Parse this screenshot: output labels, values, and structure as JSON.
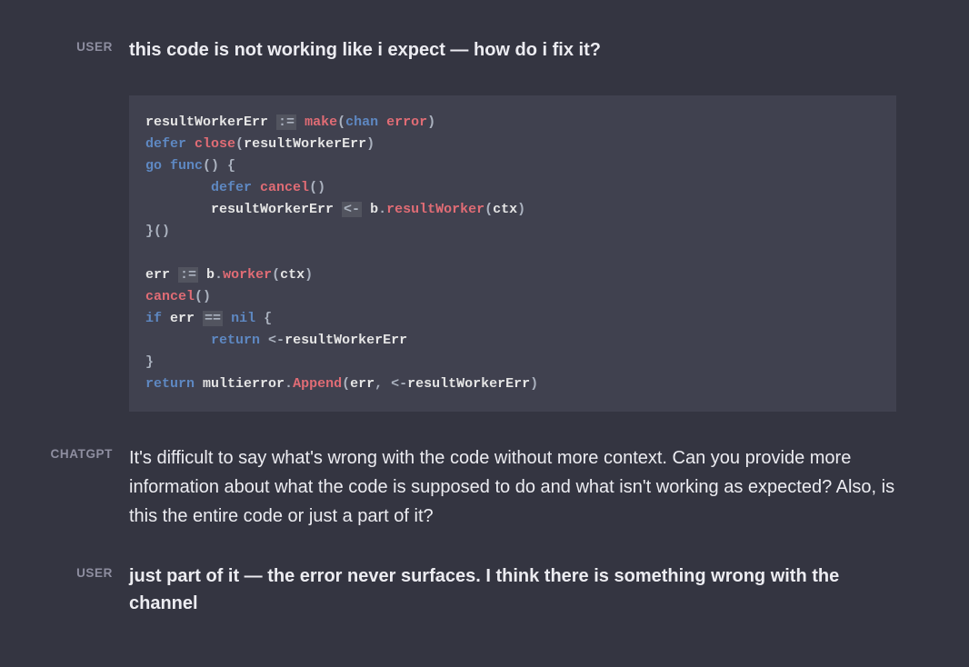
{
  "colors": {
    "background": "#343541",
    "codeBackground": "#40414f",
    "textPrimary": "#ececf1",
    "textMuted": "#8e8ea0",
    "keyword": "#5e88c2",
    "function": "#e06c75",
    "punctuation": "#abb2bf"
  },
  "messages": [
    {
      "role": "USER",
      "text": "this code is not working like i expect — how do i fix it?",
      "codeLanguage": "go",
      "code": {
        "tokens": [
          [
            {
              "t": "ident",
              "v": "resultWorkerErr "
            },
            {
              "t": "op",
              "v": ":="
            },
            {
              "t": "ident",
              "v": " "
            },
            {
              "t": "builtin",
              "v": "make"
            },
            {
              "t": "punct",
              "v": "("
            },
            {
              "t": "kw",
              "v": "chan"
            },
            {
              "t": "ident",
              "v": " "
            },
            {
              "t": "type",
              "v": "error"
            },
            {
              "t": "punct",
              "v": ")"
            }
          ],
          [
            {
              "t": "kw",
              "v": "defer"
            },
            {
              "t": "ident",
              "v": " "
            },
            {
              "t": "builtin",
              "v": "close"
            },
            {
              "t": "punct",
              "v": "("
            },
            {
              "t": "ident",
              "v": "resultWorkerErr"
            },
            {
              "t": "punct",
              "v": ")"
            }
          ],
          [
            {
              "t": "kw",
              "v": "go"
            },
            {
              "t": "ident",
              "v": " "
            },
            {
              "t": "kw",
              "v": "func"
            },
            {
              "t": "punct",
              "v": "() {"
            }
          ],
          [
            {
              "t": "ident",
              "v": "        "
            },
            {
              "t": "kw",
              "v": "defer"
            },
            {
              "t": "ident",
              "v": " "
            },
            {
              "t": "builtin",
              "v": "cancel"
            },
            {
              "t": "punct",
              "v": "()"
            }
          ],
          [
            {
              "t": "ident",
              "v": "        resultWorkerErr "
            },
            {
              "t": "chan-arrow-hl",
              "v": "<-"
            },
            {
              "t": "ident",
              "v": " b"
            },
            {
              "t": "punct",
              "v": "."
            },
            {
              "t": "builtin",
              "v": "resultWorker"
            },
            {
              "t": "punct",
              "v": "("
            },
            {
              "t": "ident",
              "v": "ctx"
            },
            {
              "t": "punct",
              "v": ")"
            }
          ],
          [
            {
              "t": "punct",
              "v": "}()"
            }
          ],
          [
            {
              "t": "ident",
              "v": ""
            }
          ],
          [
            {
              "t": "ident",
              "v": "err "
            },
            {
              "t": "op",
              "v": ":="
            },
            {
              "t": "ident",
              "v": " b"
            },
            {
              "t": "punct",
              "v": "."
            },
            {
              "t": "builtin",
              "v": "worker"
            },
            {
              "t": "punct",
              "v": "("
            },
            {
              "t": "ident",
              "v": "ctx"
            },
            {
              "t": "punct",
              "v": ")"
            }
          ],
          [
            {
              "t": "builtin",
              "v": "cancel"
            },
            {
              "t": "punct",
              "v": "()"
            }
          ],
          [
            {
              "t": "kw",
              "v": "if"
            },
            {
              "t": "ident",
              "v": " err "
            },
            {
              "t": "op",
              "v": "=="
            },
            {
              "t": "ident",
              "v": " "
            },
            {
              "t": "kw",
              "v": "nil"
            },
            {
              "t": "punct",
              "v": " {"
            }
          ],
          [
            {
              "t": "ident",
              "v": "        "
            },
            {
              "t": "kw",
              "v": "return"
            },
            {
              "t": "ident",
              "v": " "
            },
            {
              "t": "chan-arrow",
              "v": "<-"
            },
            {
              "t": "ident",
              "v": "resultWorkerErr"
            }
          ],
          [
            {
              "t": "punct",
              "v": "}"
            }
          ],
          [
            {
              "t": "kw",
              "v": "return"
            },
            {
              "t": "ident",
              "v": " multierror"
            },
            {
              "t": "punct",
              "v": "."
            },
            {
              "t": "builtin",
              "v": "Append"
            },
            {
              "t": "punct",
              "v": "("
            },
            {
              "t": "ident",
              "v": "err"
            },
            {
              "t": "punct",
              "v": ", "
            },
            {
              "t": "chan-arrow",
              "v": "<-"
            },
            {
              "t": "ident",
              "v": "resultWorkerErr"
            },
            {
              "t": "punct",
              "v": ")"
            }
          ]
        ]
      }
    },
    {
      "role": "CHATGPT",
      "text": "It's difficult to say what's wrong with the code without more context. Can you provide more information about what the code is supposed to do and what isn't working as expected? Also, is this the entire code or just a part of it?"
    },
    {
      "role": "USER",
      "text": "just part of it — the error never surfaces. I think there is something wrong with the channel"
    }
  ]
}
